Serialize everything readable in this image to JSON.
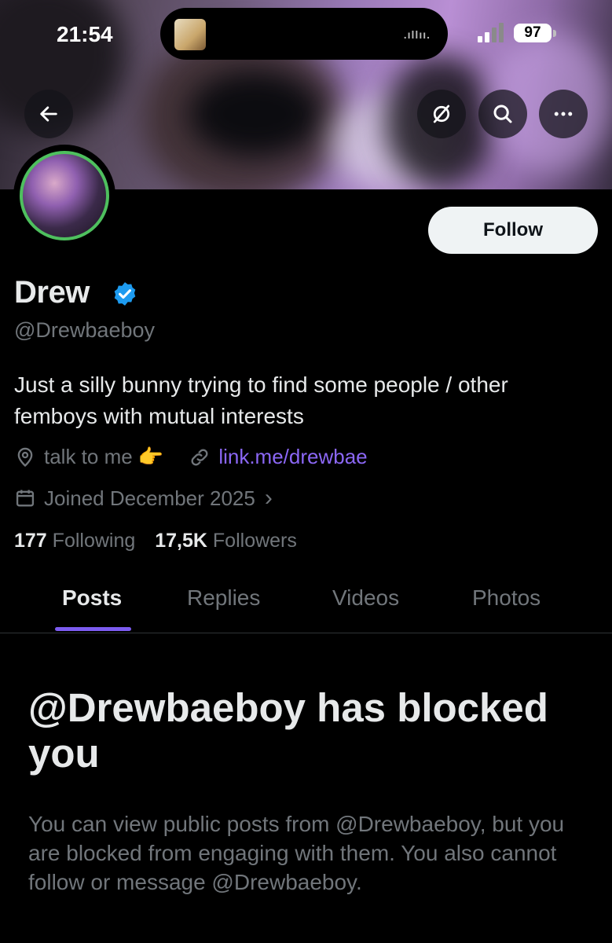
{
  "status_bar": {
    "time": "21:54",
    "battery": "97",
    "audio_wave": ".ıllıı."
  },
  "header": {
    "back_label": "←",
    "more_label": "•••"
  },
  "profile": {
    "follow_label": "Follow",
    "name": "Drew",
    "handle": "@Drewbaeboy",
    "bio": "Just a silly bunny trying to find some people / other femboys with mutual interests",
    "location": "talk to me 👉",
    "link": "link.me/drewbae",
    "joined": "Joined December 2025",
    "joined_chevron": "›",
    "following_count": "177",
    "following_label": "Following",
    "followers_count": "17,5K",
    "followers_label": "Followers"
  },
  "tabs": [
    {
      "label": "Posts",
      "active": true
    },
    {
      "label": "Replies",
      "active": false
    },
    {
      "label": "Videos",
      "active": false
    },
    {
      "label": "Photos",
      "active": false
    }
  ],
  "blocked": {
    "title": "@Drewbaeboy has blocked you",
    "message": "You can view public posts from @Drewbaeboy, but you are blocked from engaging with them. You also cannot follow or message @Drewbaeboy."
  },
  "colors": {
    "background": "#000000",
    "accent": "#7c5cf0",
    "link": "#8b67f5",
    "verified": "#1d9bf0",
    "avatar_ring": "#4ec05e",
    "muted_text": "#71767b"
  },
  "icons": [
    "back-arrow-icon",
    "unfollow-block-icon",
    "search-icon",
    "more-icon",
    "verified-badge-icon",
    "location-pin-icon",
    "link-icon",
    "calendar-icon",
    "chevron-right-icon"
  ]
}
